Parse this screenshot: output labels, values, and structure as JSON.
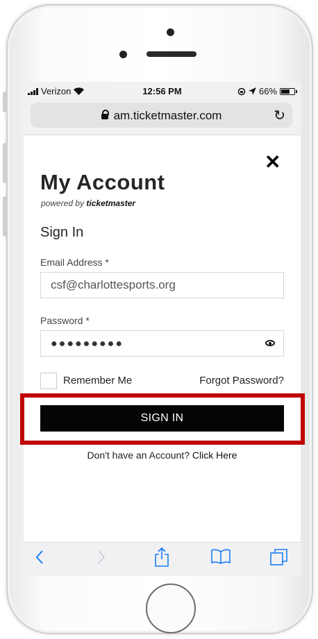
{
  "status_bar": {
    "carrier": "Verizon",
    "time": "12:56 PM",
    "battery": "66%",
    "battery_level": 0.66
  },
  "browser": {
    "url": "am.ticketmaster.com"
  },
  "page": {
    "title": "My Account",
    "powered_by_prefix": "powered by",
    "powered_by_brand": "ticketmaster",
    "section_heading": "Sign In",
    "email_label": "Email Address *",
    "email_value": "csf@charlottesports.org",
    "password_label": "Password *",
    "password_value": "●●●●●●●●●",
    "remember_label": "Remember Me",
    "forgot_label": "Forgot Password?",
    "sign_in_label": "SIGN IN",
    "signup_prompt": "Don't have an Account?",
    "signup_link": "Click Here"
  },
  "colors": {
    "highlight": "#c00000",
    "button": "#050505",
    "safari_link": "#1a7cf5"
  },
  "icons": [
    "close-icon",
    "lock-icon",
    "reload-icon",
    "eye-icon",
    "back-icon",
    "forward-icon",
    "share-icon",
    "bookmarks-icon",
    "tabs-icon",
    "wifi-icon",
    "location-icon",
    "orientation-lock-icon"
  ]
}
